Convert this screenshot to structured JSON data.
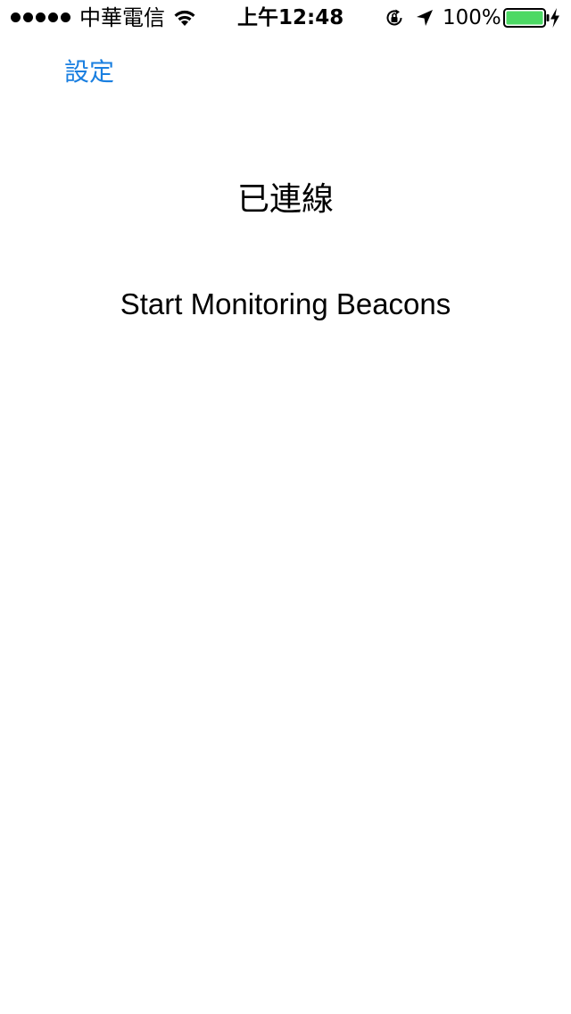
{
  "status_bar": {
    "signal_bars": 5,
    "carrier": "中華電信",
    "wifi_icon": "wifi-icon",
    "time": "上午12:48",
    "rotation_lock_icon": "rotation-lock-icon",
    "location_icon": "location-arrow-icon",
    "battery_percent": "100%",
    "battery_level": 1.0,
    "battery_color": "#4cd964",
    "charging_icon": "charging-bolt-icon"
  },
  "nav": {
    "back_label": "設定",
    "accent_color": "#1a7fe0"
  },
  "main": {
    "status_text": "已連線",
    "monitor_button_label": "Start Monitoring Beacons"
  }
}
